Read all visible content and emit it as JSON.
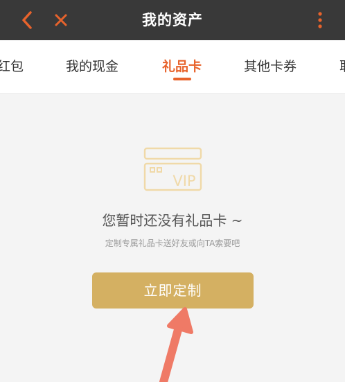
{
  "header": {
    "title": "我的资产",
    "icons": {
      "back": "chevron-left-icon",
      "close": "close-icon",
      "more": "more-vertical-icon"
    }
  },
  "tabs": [
    {
      "label": "红包",
      "active": false
    },
    {
      "label": "我的现金",
      "active": false
    },
    {
      "label": "礼品卡",
      "active": true
    },
    {
      "label": "其他卡券",
      "active": false
    },
    {
      "label": "取",
      "active": false
    }
  ],
  "empty_state": {
    "icon_text": "VIP",
    "title": "您暂时还没有礼品卡 ~",
    "subtitle": "定制专属礼品卡送好友或向TA索要吧",
    "button_label": "立即定制"
  },
  "colors": {
    "header_bg": "#393939",
    "accent": "#e8632c",
    "button_bg": "#d4b062",
    "icon_line": "#f0d9a8",
    "annotation_arrow": "#ef7a66"
  }
}
